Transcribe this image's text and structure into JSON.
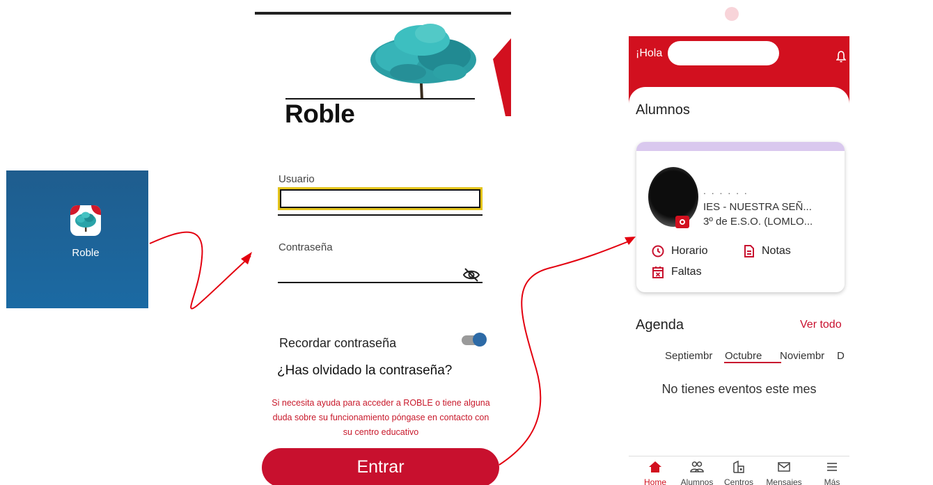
{
  "launcher": {
    "app_label": "Roble",
    "icon": "roble-tree-icon",
    "background_color": "#1f5d8e"
  },
  "login": {
    "brand_name": "Roble",
    "username_label": "Usuario",
    "username_value": "",
    "password_label": "Contraseña",
    "password_value": "",
    "show_password_icon": "eye-off-icon",
    "remember_label": "Recordar contraseña",
    "remember_enabled": true,
    "forgot_link": "¿Has olvidado la contraseña?",
    "help_text": "Si necesita ayuda para acceder a ROBLE o tiene alguna duda sobre su funcionamiento póngase en contacto con su centro educativo",
    "enter_button": "Entrar",
    "accent_color": "#c8102e",
    "focus_color": "#e3c31a"
  },
  "home": {
    "greeting": "¡Hola",
    "bell_icon": "bell-icon",
    "students_title": "Alumnos",
    "student": {
      "name": ". . . . . .",
      "school": "IES - NUESTRA SEÑ...",
      "course": "3º de E.S.O. (LOMLO..."
    },
    "actions": {
      "schedule": "Horario",
      "grades": "Notas",
      "absences": "Faltas"
    },
    "agenda_title": "Agenda",
    "see_all": "Ver todo",
    "months": {
      "prev": "Septiembr",
      "current": "Octubre",
      "next": "Noviembr",
      "next2": "D"
    },
    "no_events": "No tienes eventos este mes",
    "nav": {
      "home": "Home",
      "students": "Alumnos",
      "centers": "Centros",
      "messages": "Mensajes",
      "more": "Más"
    },
    "header_color": "#d2101f"
  }
}
